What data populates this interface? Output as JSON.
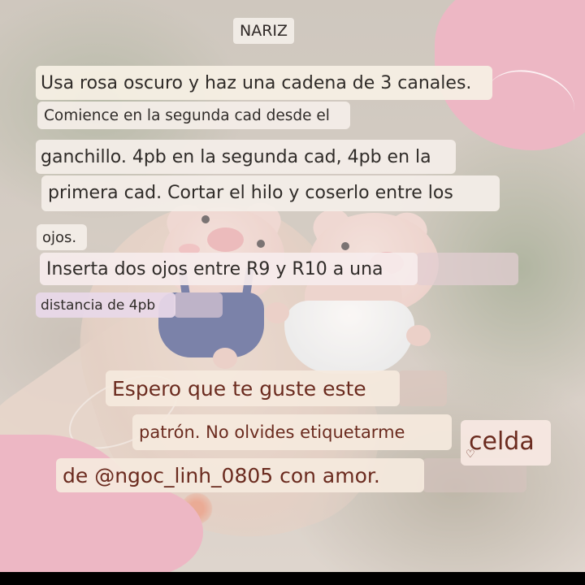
{
  "title": "NARIZ",
  "instructions": [
    "Usa rosa oscuro y haz una cadena de 3 canales.",
    "Comience en la segunda cad desde el",
    "ganchillo. 4pb en la segunda cad, 4pb en la",
    "primera cad. Cortar el hilo y coserlo entre los",
    "ojos.",
    "Inserta dos ojos entre R9 y R10 a una",
    "distancia de 4pb"
  ],
  "closing": [
    "Espero que te guste este",
    "patrón. No olvides etiquetarme",
    "de @ngoc_linh_0805 con amor."
  ],
  "tag": "celda",
  "colors": {
    "blob_pink": "#edb7c4",
    "closing_text": "#6b2b1f",
    "body_text": "#2f2b28"
  }
}
